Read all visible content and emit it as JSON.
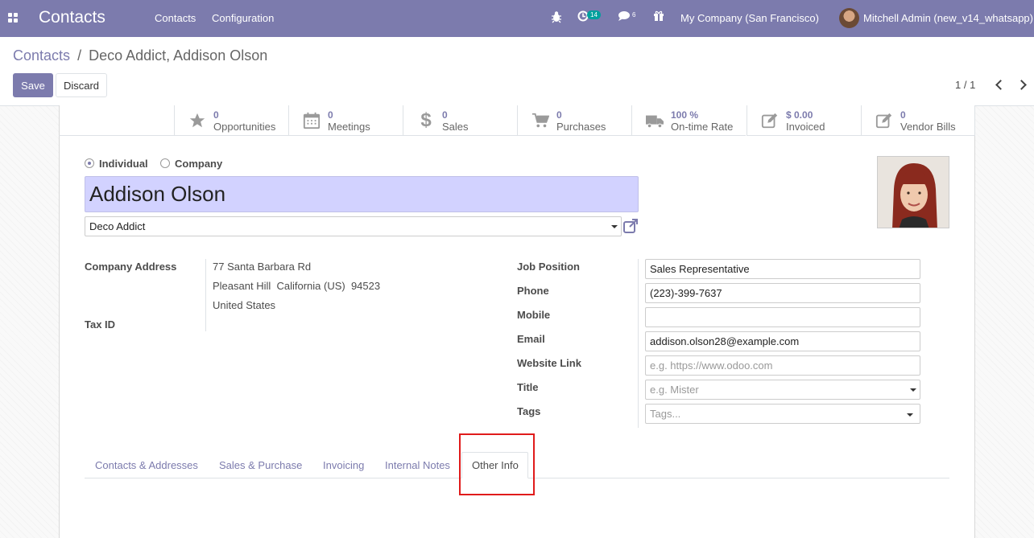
{
  "navbar": {
    "brand": "Contacts",
    "menu": [
      "Contacts",
      "Configuration"
    ],
    "activity_count": "14",
    "message_count": "6",
    "company": "My Company (San Francisco)",
    "user": "Mitchell Admin (new_v14_whatsapp)"
  },
  "breadcrumb": {
    "parent": "Contacts",
    "separator": "/",
    "current": "Deco Addict, Addison Olson"
  },
  "buttons": {
    "save": "Save",
    "discard": "Discard"
  },
  "pager": {
    "value": "1 / 1"
  },
  "stat_buttons": [
    {
      "icon": "star-icon",
      "value": "0",
      "label": "Opportunities"
    },
    {
      "icon": "calendar-icon",
      "value": "0",
      "label": "Meetings"
    },
    {
      "icon": "dollar-icon",
      "value": "0",
      "label": "Sales"
    },
    {
      "icon": "cart-icon",
      "value": "0",
      "label": "Purchases"
    },
    {
      "icon": "truck-icon",
      "value": "100 %",
      "label": "On-time Rate"
    },
    {
      "icon": "pencil-square-icon",
      "value": "$ 0.00",
      "label": "Invoiced"
    },
    {
      "icon": "pencil-square-icon",
      "value": "0",
      "label": "Vendor Bills"
    }
  ],
  "form": {
    "type_options": [
      "Individual",
      "Company"
    ],
    "type_selected": "Individual",
    "name": "Addison Olson",
    "parent_company": "Deco Addict",
    "labels": {
      "company_address": "Company Address",
      "tax_id": "Tax ID",
      "job_position": "Job Position",
      "phone": "Phone",
      "mobile": "Mobile",
      "email": "Email",
      "website": "Website Link",
      "title": "Title",
      "tags": "Tags"
    },
    "address": {
      "street": "77 Santa Barbara Rd",
      "city_line": "Pleasant Hill  California (US)  94523",
      "country": "United States"
    },
    "values": {
      "job_position": "Sales Representative",
      "phone": "(223)-399-7637",
      "mobile": "",
      "email": "addison.olson28@example.com"
    },
    "placeholders": {
      "website": "e.g. https://www.odoo.com",
      "title": "e.g. Mister",
      "tags": "Tags..."
    }
  },
  "tabs": [
    "Contacts & Addresses",
    "Sales & Purchase",
    "Invoicing",
    "Internal Notes",
    "Other Info"
  ],
  "active_tab": "Other Info",
  "colors": {
    "brand": "#7c7bad",
    "name_field_bg": "#d2d2ff",
    "highlight": "#e01b1b"
  }
}
